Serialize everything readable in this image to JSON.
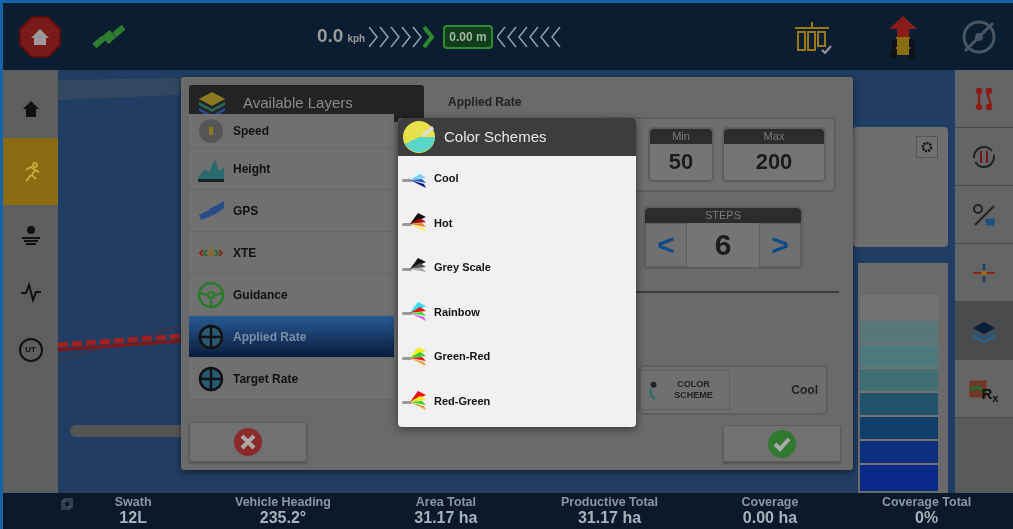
{
  "top_bar": {
    "speed": "0.0",
    "speed_unit": "kph",
    "offset": "0.00 m"
  },
  "left_sidebar": [
    {
      "kind": "home",
      "selected": false
    },
    {
      "kind": "run",
      "selected": true
    },
    {
      "kind": "settings",
      "selected": false
    },
    {
      "kind": "pulse",
      "selected": false
    },
    {
      "kind": "ut",
      "label": "UT",
      "selected": false
    }
  ],
  "right_sidebar": [
    {
      "kind": "lines",
      "selected": false
    },
    {
      "kind": "cycle",
      "selected": false
    },
    {
      "kind": "pin",
      "selected": false
    },
    {
      "kind": "center",
      "selected": false
    },
    {
      "kind": "layers",
      "selected": true
    },
    {
      "kind": "rx",
      "label": "R$_{x}$",
      "selected": false
    }
  ],
  "dialog": {
    "layers_title": "Available Layers",
    "layers": [
      {
        "label": "Speed",
        "kind": "gauge",
        "selected": false
      },
      {
        "label": "Height",
        "kind": "height",
        "selected": false
      },
      {
        "label": "GPS",
        "kind": "satellite",
        "selected": false
      },
      {
        "label": "XTE",
        "kind": "arrows",
        "selected": false
      },
      {
        "label": "Guidance",
        "kind": "wheel",
        "selected": false
      },
      {
        "label": "Applied Rate",
        "kind": "rate",
        "selected": true
      },
      {
        "label": "Target Rate",
        "kind": "rate",
        "selected": false
      }
    ],
    "detail": {
      "title": "Applied Rate",
      "min_label": "Min",
      "min_value": "50",
      "max_label": "Max",
      "max_value": "200",
      "steps_label": "STEPS",
      "steps_value": "6",
      "prev": "<",
      "next": ">",
      "scheme_button": "COLOR SCHEME",
      "scheme_value": "Cool"
    }
  },
  "popup": {
    "title": "Color Schemes",
    "schemes": [
      {
        "label": "Cool",
        "kind": "cool"
      },
      {
        "label": "Hot",
        "kind": "hot"
      },
      {
        "label": "Grey Scale",
        "kind": "grey"
      },
      {
        "label": "Rainbow",
        "kind": "rainbow"
      },
      {
        "label": "Green-Red",
        "kind": "greenred"
      },
      {
        "label": "Red-Green",
        "kind": "redgreen"
      }
    ]
  },
  "status": [
    {
      "label": "Swath",
      "value": "12L"
    },
    {
      "label": "Vehicle Heading",
      "value": "235.2°"
    },
    {
      "label": "Area Total",
      "value": "31.17 ha"
    },
    {
      "label": "Productive Total",
      "value": "31.17 ha"
    },
    {
      "label": "Coverage",
      "value": "0.00 ha"
    },
    {
      "label": "Coverage Total",
      "value": "0%"
    }
  ]
}
